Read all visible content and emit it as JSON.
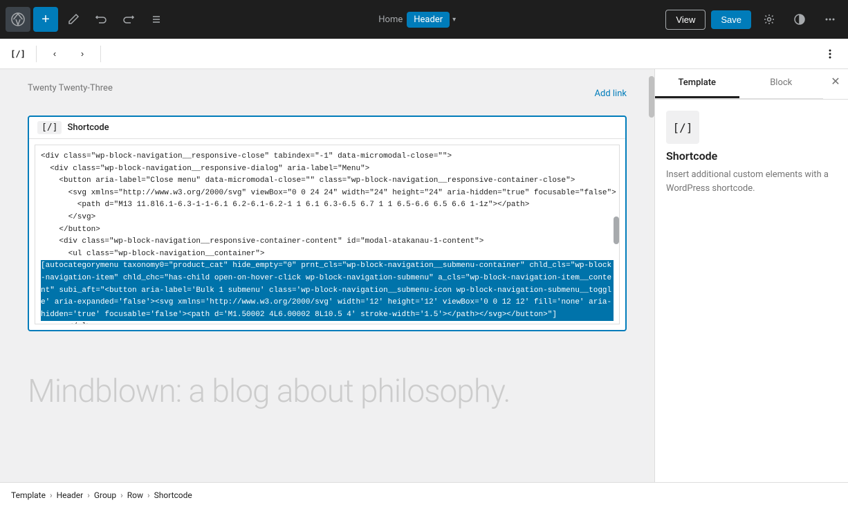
{
  "toolbar": {
    "add_label": "+",
    "view_label": "View",
    "save_label": "Save",
    "breadcrumb_home": "Home",
    "breadcrumb_header": "Header",
    "chevron": "▾"
  },
  "secondary_toolbar": {
    "bracket_icon": "[/]",
    "back_icon": "‹",
    "forward_icon": "›",
    "list_icon": "≡",
    "dots_icon": "⋮"
  },
  "canvas": {
    "page_label": "Twenty Twenty-Three",
    "add_link": "Add link",
    "block_title": "Shortcode",
    "block_icon": "[/]",
    "code_lines": [
      "<div class=\"wp-block-navigation__responsive-close\" tabindex=\"-1\" data-micromodal-close=\"\">",
      "  <div class=\"wp-block-navigation__responsive-dialog\" aria-label=\"Menu\">",
      "    <button aria-label=\"Close menu\" data-micromodal-close=\"\" class=\"wp-block-navigation__responsive-container-close\">",
      "      <svg xmlns=\"http://www.w3.org/2000/svg\" viewBox=\"0 0 24 24\" width=\"24\" height=\"24\" aria-hidden=\"true\" focusable=\"false\">",
      "        <path d=\"M13 11.8l6.1-6.3-1-1-6.1 6.2-6.1-6.2-1 1 6.1 6.3-6.5 6.7 1 1 6.5-6.6 6.5 6.6 1-1z\"></path>",
      "      </svg>",
      "    </button>",
      "    <div class=\"wp-block-navigation__responsive-container-content\" id=\"modal-atakanau-1-content\">",
      "      <ul class=\"wp-block-navigation__container\">"
    ],
    "code_highlighted": "[autocategorymenu taxonomy0=\"product_cat\" hide_empty=\"0\" prnt_cls=\"wp-block-navigation__submenu-container\" chld_cls=\"wp-block-navigation-item\" chld_chc=\"has-child open-on-hover-click wp-block-navigation-submenu\" a_cls=\"wp-block-navigation-item__content\" subi_aft=\"<button aria-label='Bulk 1 submenu' class='wp-block-navigation__submenu-icon wp-block-navigation-submenu__toggle' aria-expanded='false'><svg xmlns='http://www.w3.org/2000/svg' width='12' height='12' viewBox='0 0 12 12' fill='none' aria-hidden='true' focusable='false'><path d='M1.50002 4L6.00002 8L10.5 4' stroke-width='1.5'></path></svg></button>\"]",
    "blog_title": "Mindblown: a blog about philosophy."
  },
  "right_panel": {
    "tab_template": "Template",
    "tab_block": "Block",
    "block_icon": "[/]",
    "block_title": "Shortcode",
    "block_desc": "Insert additional custom elements with a WordPress shortcode."
  },
  "bottom_breadcrumb": {
    "items": [
      "Template",
      "Header",
      "Group",
      "Row",
      "Shortcode"
    ]
  }
}
